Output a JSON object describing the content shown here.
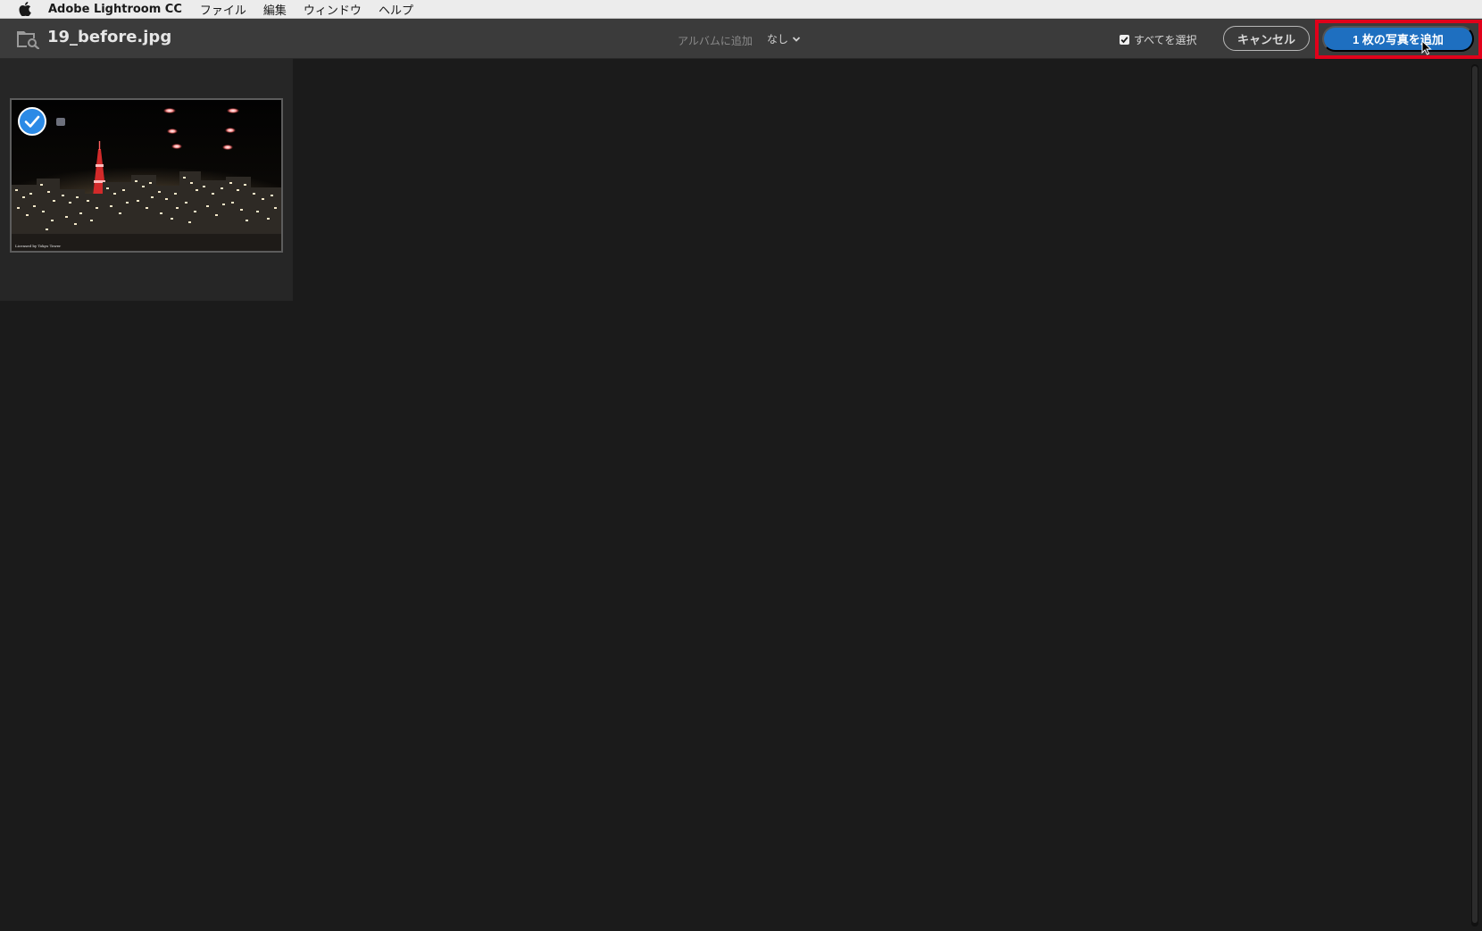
{
  "menubar": {
    "app_name": "Adobe Lightroom CC",
    "items": [
      "ファイル",
      "編集",
      "ウィンドウ",
      "ヘルプ"
    ]
  },
  "toolbar": {
    "file_title": "19_before.jpg",
    "album_label": "アルバムに追加",
    "album_value": "なし",
    "select_all_label": "すべてを選択",
    "select_all_checked": true,
    "cancel_label": "キャンセル",
    "add_label": "1 枚の写真を追加"
  },
  "colors": {
    "accent": "#1e6fc0",
    "highlight": "#e1001a",
    "background": "#1b1b1b",
    "toolbar": "#3b3b3b"
  },
  "grid": {
    "photos": [
      {
        "selected": true,
        "watermark": "Licensed by Tokyo Tower"
      }
    ]
  }
}
